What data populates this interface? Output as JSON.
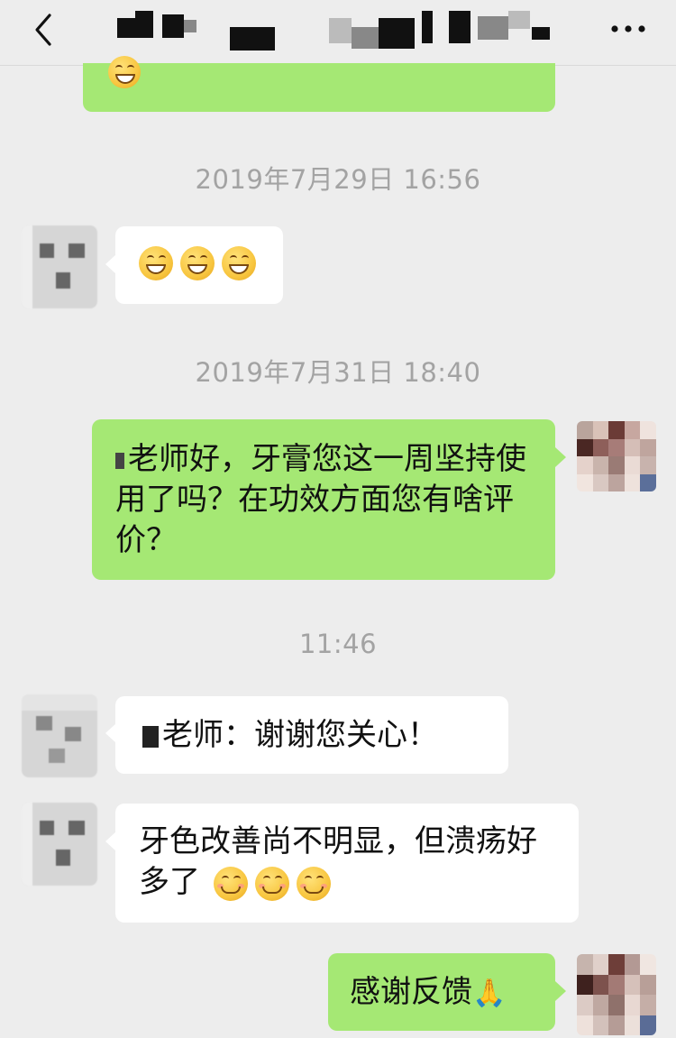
{
  "header": {
    "back_icon": "chevron-left-icon",
    "more_icon": "ellipsis-icon"
  },
  "messages": {
    "ts1": "2019年7月29日 16:56",
    "ts2": "2019年7月31日 18:40",
    "ts3": "11:46",
    "out1_text": "老师好，牙膏您这一周坚持使用了吗？在功效方面您有啥评价？",
    "in2_text": "老师：谢谢您关心！",
    "in3_text": "牙色改善尚不明显，但溃疡好多了",
    "out2_text": "感谢反馈"
  },
  "colors": {
    "background": "#ededed",
    "outgoing_bubble": "#a5e874",
    "incoming_bubble": "#ffffff",
    "timestamp": "#a3a3a3"
  }
}
